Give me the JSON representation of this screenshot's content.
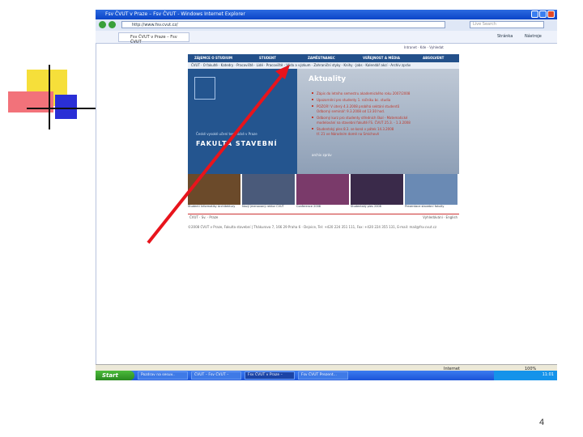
{
  "window": {
    "title": "Fsv ČVUT v Praze – Fsv ČVUT - Windows Internet Explorer",
    "url": "http://www.fsv.cvut.cz/",
    "search_placeholder": "Live Search",
    "tab_label": "Fsv ČVUT v Praze – Fsv ČVUT",
    "cmd_page": "Stránka",
    "cmd_tools": "Nástroje"
  },
  "site": {
    "util_links": "Intranet · Kde · Vyhledat",
    "menu": [
      "ZÁJEMCE O STUDIUM",
      "STUDENT",
      "ZAMĚSTNANEC",
      "VEŘEJNOST A MÉDIA",
      "ABSOLVENT"
    ],
    "submenu": "ČVUT · O fakultě · Katedry · Pracoviště · Lidé · Pracoviště · Věda a výzkum · Zahraniční styky · Knihy · Jobs · Kalendář akcí · Archiv zpráv",
    "faculty_subtitle": "České vysoké učení technické v Praze",
    "faculty_name": "FAKULTA STAVEBNÍ",
    "news_heading": "Aktuality",
    "news": [
      "Zápis do letního semestru akademického roku 2007/2008",
      "Upozornění pro studenty 1. ročníku bc. studia",
      "POZOR! V úterý 4.3.2008 probíhá sektání studentů",
      "Odborný seminář: 9.3.2008 od 13:30 hod.",
      "Odborný kurz pro studenty středních škol - Matematické",
      "modelování na stavební fakultě FS. ČVUT 25.3. - 1.3.2008",
      "Studentský ples 8.3. se koná v pátek 14.3.2008",
      "tř. 21 ve Národním domě na Smíchově"
    ],
    "more_link": "archiv zpráv",
    "tiles": [
      {
        "caption": "Studenti Informatiky Architektury",
        "color": "#6b4a2a"
      },
      {
        "caption": "Nový jmenovaný rektor ČVUT",
        "color": "#4a5a7a"
      },
      {
        "caption": "Conference 2008",
        "color": "#7a3a6a"
      },
      {
        "caption": "Studentský ples 2008",
        "color": "#3a2a4a"
      },
      {
        "caption": "Prezentace stavební fakulty",
        "color": "#6a8ab4"
      }
    ],
    "footer_left": "ČVUT · Sv. · Praze",
    "footer_right": "Vyhledávání · English",
    "footer_info": "©2008 ČVUT v Praze, Fakulta stavební | Thákurova 7, 166 29 Praha 6 - Dejvice, Tel: +420 224 351 111, Fax: +420 224 355 131, E-mail: mail@fsv.cvut.cz"
  },
  "statusbar": {
    "zone": "Internet",
    "zoom": "100%"
  },
  "taskbar": {
    "start_label": "Start",
    "tasks": [
      "Pozdrav na sesuv..",
      "ČVUT – Fsv ČVUT –",
      "Fsv ČVUT v Praze –",
      "Fsv ČVUT Prezent..."
    ],
    "clock": "11:01"
  },
  "slide": {
    "page_number": "4"
  },
  "colors": {
    "annotation_arrow": "#e8141c",
    "site_blue": "#24558f"
  }
}
